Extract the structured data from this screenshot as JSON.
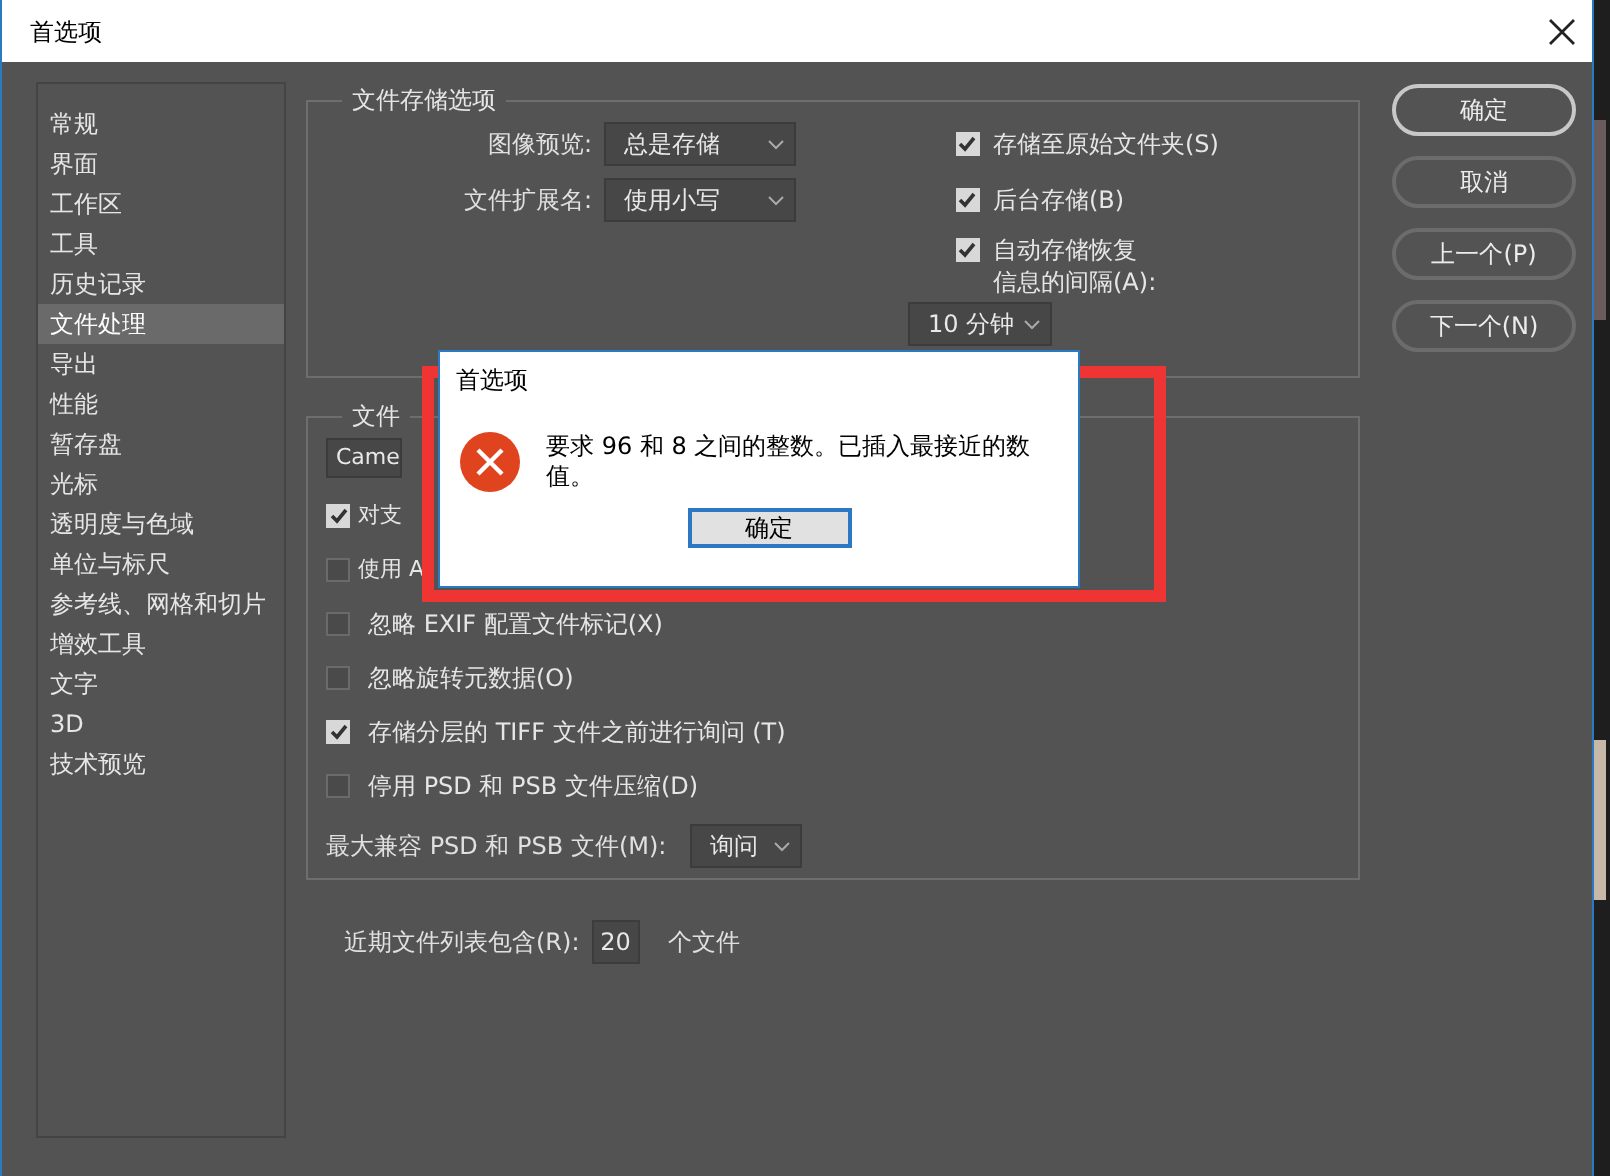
{
  "window": {
    "title": "首选项"
  },
  "sidebar": {
    "items": [
      {
        "label": "常规",
        "selected": false
      },
      {
        "label": "界面",
        "selected": false
      },
      {
        "label": "工作区",
        "selected": false
      },
      {
        "label": "工具",
        "selected": false
      },
      {
        "label": "历史记录",
        "selected": false
      },
      {
        "label": "文件处理",
        "selected": true
      },
      {
        "label": "导出",
        "selected": false
      },
      {
        "label": "性能",
        "selected": false
      },
      {
        "label": "暂存盘",
        "selected": false
      },
      {
        "label": "光标",
        "selected": false
      },
      {
        "label": "透明度与色域",
        "selected": false
      },
      {
        "label": "单位与标尺",
        "selected": false
      },
      {
        "label": "参考线、网格和切片",
        "selected": false
      },
      {
        "label": "增效工具",
        "selected": false
      },
      {
        "label": "文字",
        "selected": false
      },
      {
        "label": "3D",
        "selected": false
      },
      {
        "label": "技术预览",
        "selected": false
      }
    ]
  },
  "file_save_options": {
    "title": "文件存储选项",
    "image_preview": {
      "label": "图像预览:",
      "value": "总是存储"
    },
    "file_extension": {
      "label": "文件扩展名:",
      "value": "使用小写"
    },
    "checkboxes": [
      {
        "label": "存储至原始文件夹(S)",
        "checked": true
      },
      {
        "label": "后台存储(B)",
        "checked": true
      },
      {
        "label_lines": [
          "自动存储恢复",
          "信息的间隔(A):"
        ],
        "checked": true
      }
    ],
    "autosave_interval": {
      "value": "10 分钟"
    }
  },
  "file_compatibility": {
    "title": "文件",
    "dropdown": {
      "value": "Came"
    },
    "options": [
      {
        "label": "对支",
        "checked": true
      },
      {
        "label": "使用 A",
        "checked": false
      },
      {
        "label": "忽略 EXIF 配置文件标记(X)",
        "checked": false
      },
      {
        "label": "忽略旋转元数据(O)",
        "checked": false
      },
      {
        "label": "存储分层的 TIFF 文件之前进行询问 (T)",
        "checked": true
      },
      {
        "label": "停用 PSD 和 PSB 文件压缩(D)",
        "checked": false
      }
    ],
    "max_compatibility": {
      "label": "最大兼容 PSD 和 PSB 文件(M):",
      "value": "询问"
    }
  },
  "recent_files": {
    "label": "近期文件列表包含(R):",
    "value": "20",
    "unit": "个文件"
  },
  "buttons": [
    {
      "label": "确定",
      "default": true
    },
    {
      "label": "取消",
      "default": false
    },
    {
      "label": "上一个(P)",
      "default": false
    },
    {
      "label": "下一个(N)",
      "default": false
    }
  ],
  "alert": {
    "title": "首选项",
    "message": "要求 96 和 8 之间的整数。已插入最接近的数值。",
    "button": "确定"
  }
}
